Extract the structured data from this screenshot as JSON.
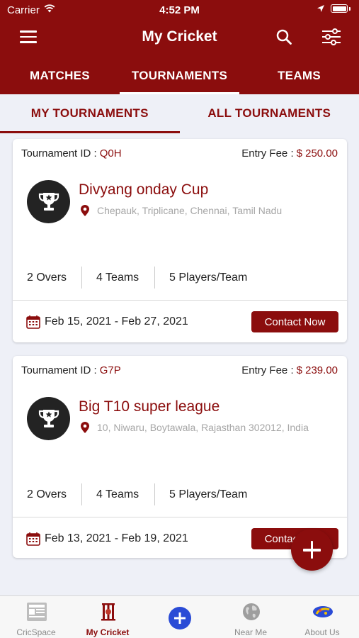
{
  "status_bar": {
    "carrier": "Carrier",
    "time": "4:52 PM"
  },
  "header": {
    "title": "My Cricket",
    "icons": [
      "hamburger-menu-icon",
      "search-icon",
      "filter-sliders-icon"
    ]
  },
  "main_tabs": [
    {
      "label": "MATCHES",
      "active": false
    },
    {
      "label": "TOURNAMENTS",
      "active": true
    },
    {
      "label": "TEAMS",
      "active": false
    }
  ],
  "sub_tabs": [
    {
      "label": "MY TOURNAMENTS",
      "active": true
    },
    {
      "label": "ALL TOURNAMENTS",
      "active": false
    }
  ],
  "tournaments": [
    {
      "id_label": "Tournament ID :",
      "id": "Q0H",
      "fee_label": "Entry Fee :",
      "fee": "$ 250.00",
      "name": "Divyang onday Cup",
      "location": "Chepauk, Triplicane, Chennai, Tamil Nadu",
      "overs": "2 Overs",
      "teams": "4 Teams",
      "players": "5 Players/Team",
      "dates": "Feb 15, 2021 - Feb 27, 2021",
      "contact_label": "Contact Now"
    },
    {
      "id_label": "Tournament ID :",
      "id": "G7P",
      "fee_label": "Entry Fee :",
      "fee": "$ 239.00",
      "name": "Big T10 super league",
      "location": "10, Niwaru, Boytawala, Rajasthan 302012, India",
      "overs": "2 Overs",
      "teams": "4 Teams",
      "players": "5 Players/Team",
      "dates": "Feb 13, 2021 - Feb 19, 2021",
      "contact_label": "Contact Now"
    }
  ],
  "bottom_nav": [
    {
      "label": "CricSpace",
      "icon": "cricspace-icon",
      "active": false
    },
    {
      "label": "My Cricket",
      "icon": "my-cricket-icon",
      "active": true
    },
    {
      "label": "",
      "icon": "add-circle-icon",
      "active": false
    },
    {
      "label": "Near Me",
      "icon": "globe-icon",
      "active": false
    },
    {
      "label": "About Us",
      "icon": "about-us-icon",
      "active": false
    }
  ],
  "colors": {
    "primary": "#8b0d0d",
    "background": "#eef0f7",
    "muted_text": "#a6a6a6",
    "nav_blue": "#2a4bd6"
  }
}
